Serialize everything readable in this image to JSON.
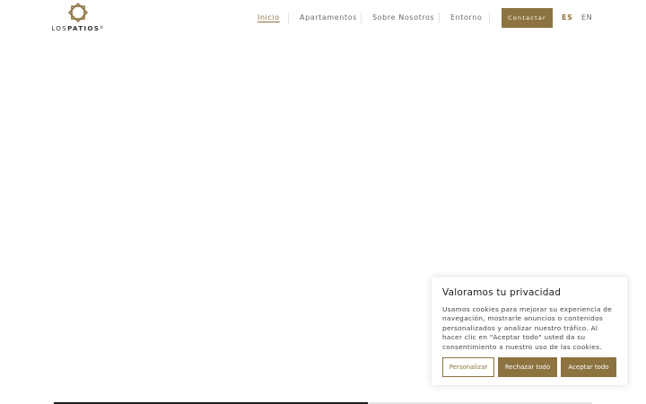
{
  "logo": {
    "text_thin": "LOS",
    "text_bold": "PATIOS",
    "trademark": "®",
    "icon": "star-flower-icon"
  },
  "nav": {
    "items": [
      "Inicio",
      "Apartamentos",
      "Sobre Nosotros",
      "Entorno"
    ],
    "active": "Inicio",
    "contact_label": "Contactar",
    "languages": [
      "ES",
      "EN"
    ],
    "active_language": "ES"
  },
  "cookie": {
    "title": "Valoramos tu privacidad",
    "body": "Usamos cookies para mejorar su experiencia de navegación, mostrarle anuncios o contenidos personalizados y analizar nuestro tráfico. Al hacer clic en \"Aceptar todo\" usted da su consentimiento a nuestro uso de las cookies.",
    "customize_label": "Personalizar",
    "reject_label": "Rechazar todo",
    "accept_label": "Aceptar todo"
  },
  "slider": {
    "progress": 0.583
  },
  "colors": {
    "accent": "#8c7340",
    "text": "#3a3a3a"
  }
}
